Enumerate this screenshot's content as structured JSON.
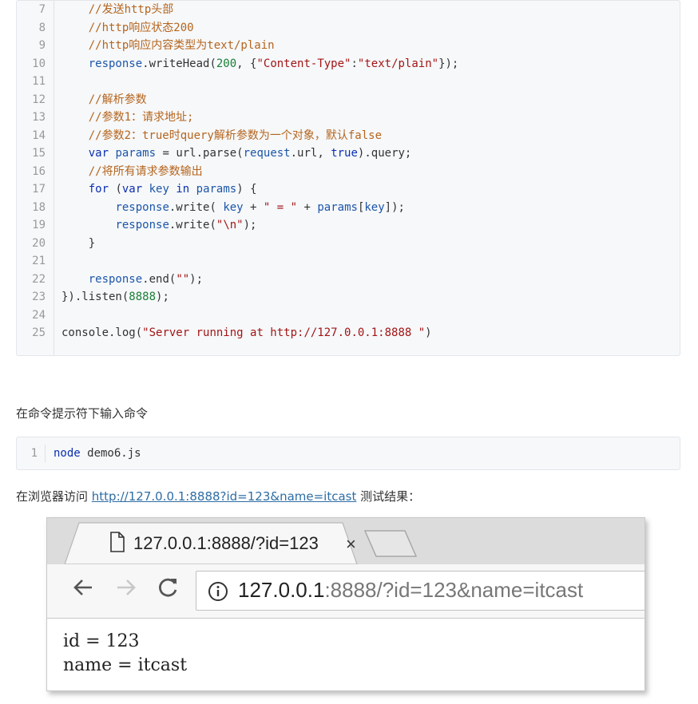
{
  "code_block_1": {
    "lines": [
      {
        "n": "7",
        "t": "    //发送http头部"
      },
      {
        "n": "8",
        "t": "    //http响应状态200"
      },
      {
        "n": "9",
        "t": "    //http响应内容类型为text/plain"
      },
      {
        "n": "10",
        "t": "    response.writeHead(200, {\"Content-Type\":\"text/plain\"});"
      },
      {
        "n": "11",
        "t": ""
      },
      {
        "n": "12",
        "t": "    //解析参数"
      },
      {
        "n": "13",
        "t": "    //参数1：请求地址;"
      },
      {
        "n": "14",
        "t": "    //参数2：true时query解析参数为一个对象，默认false"
      },
      {
        "n": "15",
        "t": "    var params = url.parse(request.url, true).query;"
      },
      {
        "n": "16",
        "t": "    //将所有请求参数输出"
      },
      {
        "n": "17",
        "t": "    for (var key in params) {"
      },
      {
        "n": "18",
        "t": "        response.write( key + \" = \" + params[key]);"
      },
      {
        "n": "19",
        "t": "        response.write(\"\\n\");"
      },
      {
        "n": "20",
        "t": "    }"
      },
      {
        "n": "21",
        "t": ""
      },
      {
        "n": "22",
        "t": "    response.end(\"\");"
      },
      {
        "n": "23",
        "t": "}).listen(8888);"
      },
      {
        "n": "24",
        "t": ""
      },
      {
        "n": "25",
        "t": "console.log(\"Server running at http://127.0.0.1:8888 \")"
      }
    ]
  },
  "paragraph_1": "在命令提示符下输入命令",
  "code_block_2": {
    "lines": [
      {
        "n": "1",
        "t": "node demo6.js"
      }
    ]
  },
  "paragraph_2": {
    "before": "在浏览器访问 ",
    "link": "http://127.0.0.1:8888?id=123&name=itcast",
    "after": " 测试结果："
  },
  "browser": {
    "tab_title": "127.0.0.1:8888/?id=123",
    "tab_close": "×",
    "address_host": "127.0.0.1",
    "address_rest": ":8888/?id=123&name=itcast",
    "content_lines": [
      "id = 123",
      "name = itcast"
    ],
    "icons": {
      "page": "page-icon",
      "back": "back-arrow-icon",
      "forward": "forward-arrow-icon",
      "reload": "reload-icon",
      "info": "info-icon"
    }
  },
  "colors": {
    "code_bg": "#f6f8fa",
    "comment": "#b5651d",
    "keyword": "#0b2fb0",
    "string": "#a31515",
    "number": "#1a7f37",
    "link": "#2e6da4"
  }
}
